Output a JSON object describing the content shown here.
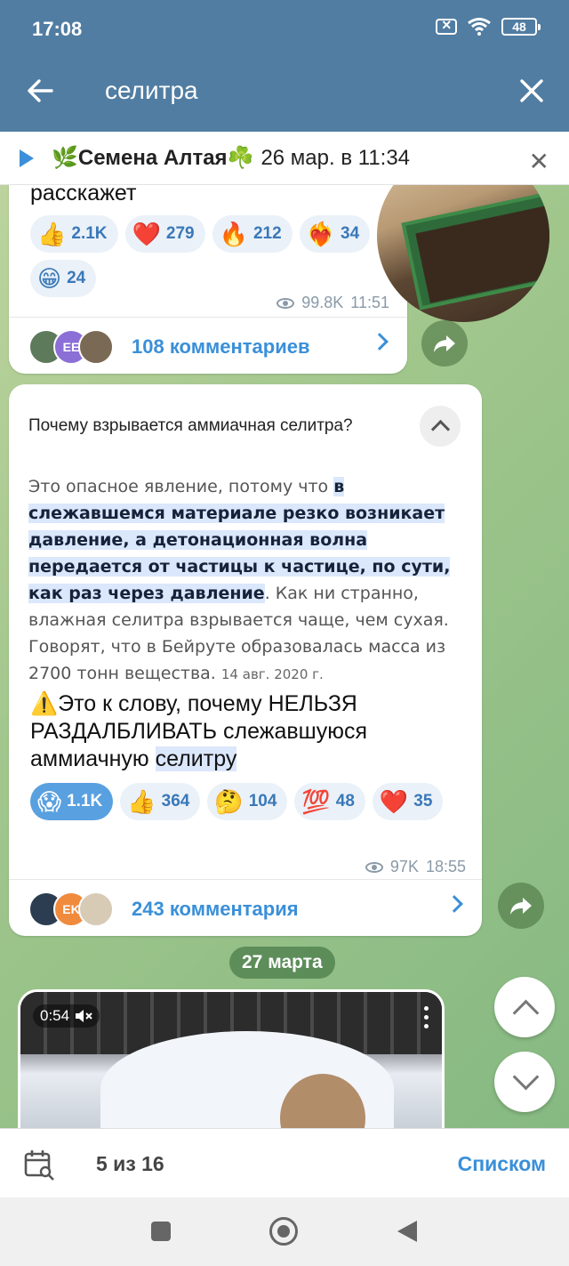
{
  "status": {
    "time": "17:08",
    "battery": "48"
  },
  "search": {
    "query": "селитра"
  },
  "pinned": {
    "channel": "🌿Семена Алтая☘️",
    "date": "26 мар. в 11:34"
  },
  "post1": {
    "tail_text": "расскажет",
    "reactions": [
      {
        "emoji": "👍",
        "count": "2.1K"
      },
      {
        "emoji": "❤️",
        "count": "279"
      },
      {
        "emoji": "🔥",
        "count": "212"
      },
      {
        "emoji": "❤️‍🔥",
        "count": "34"
      },
      {
        "emoji": "😁",
        "count": "24"
      }
    ],
    "views": "99.8K",
    "time": "11:51",
    "comments": "108 комментариев",
    "avatar_initials": "EE"
  },
  "post2": {
    "snippet_question": "Почему взрывается аммиачная селитра?",
    "snippet_plain_start": "Это опасное явление, потому что ",
    "snippet_highlight": "в слежавшемся материале резко возникает давление, а детонационная волна передается от частицы к частице, по сути, как раз через давление",
    "snippet_plain_end": ". Как ни странно, влажная селитра взрывается чаще, чем сухая. Говорят, что в Бейруте образовалась масса из 2700 тонн вещества.",
    "snippet_date": "14 авг. 2020 г.",
    "message_prefix": "⚠️Это к слову, почему НЕЛЬЗЯ РАЗДАЛБЛИВАТЬ слежавшуюся аммиачную ",
    "message_match": "селитру",
    "reactions": [
      {
        "emoji": "😱",
        "count": "1.1K",
        "active": true
      },
      {
        "emoji": "👍",
        "count": "364"
      },
      {
        "emoji": "🤔",
        "count": "104"
      },
      {
        "emoji": "💯",
        "count": "48"
      },
      {
        "emoji": "❤️",
        "count": "35"
      }
    ],
    "views": "97K",
    "time": "18:55",
    "comments": "243 комментария",
    "avatar_initials": "EK"
  },
  "date_separator": "27 марта",
  "video": {
    "duration": "0:54"
  },
  "bottom": {
    "counter": "5 из 16",
    "list_button": "Списком"
  },
  "colors": {
    "header": "#517da2",
    "accent": "#3a8fd8"
  }
}
